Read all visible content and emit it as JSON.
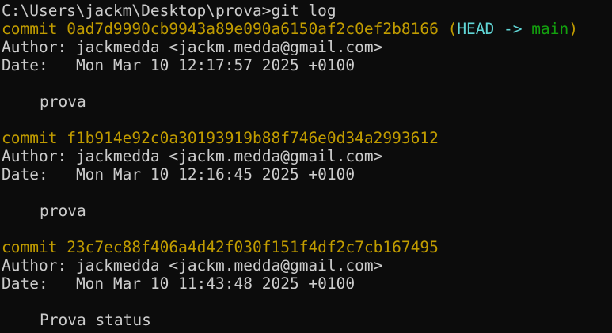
{
  "terminal": {
    "prompt": "C:\\Users\\jackm\\Desktop\\prova>",
    "command": "git log",
    "colors": {
      "background": "#0c0c0c",
      "foreground": "#cccccc",
      "commit": "#c19c00",
      "head": "#61d6d6",
      "branch": "#13a10e"
    },
    "commits": [
      {
        "label": "commit",
        "hash": "0ad7d9990cb9943a89e090a6150af2c0ef2b8166",
        "ref_open": "(",
        "head": "HEAD",
        "arrow": "->",
        "branch": "main",
        "ref_close": ")",
        "author_label": "Author:",
        "author": "jackmedda <jackm.medda@gmail.com>",
        "date_label": "Date:",
        "date": "Mon Mar 10 12:17:57 2025 +0100",
        "message": "prova"
      },
      {
        "label": "commit",
        "hash": "f1b914e92c0a30193919b88f746e0d34a2993612",
        "author_label": "Author:",
        "author": "jackmedda <jackm.medda@gmail.com>",
        "date_label": "Date:",
        "date": "Mon Mar 10 12:16:45 2025 +0100",
        "message": "prova"
      },
      {
        "label": "commit",
        "hash": "23c7ec88f406a4d42f030f151f4df2c7cb167495",
        "author_label": "Author:",
        "author": "jackmedda <jackm.medda@gmail.com>",
        "date_label": "Date:",
        "date": "Mon Mar 10 11:43:48 2025 +0100",
        "message": "Prova status"
      }
    ]
  }
}
